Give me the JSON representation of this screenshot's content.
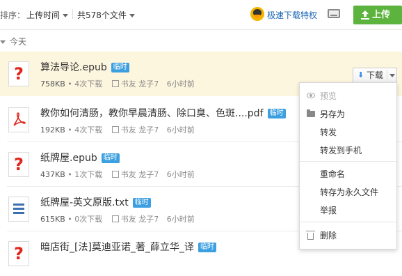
{
  "toolbar": {
    "sort_label": "排序：",
    "sort_value": "上传时间",
    "file_count": "共578个文件",
    "vip_link": "极速下载特权",
    "upload_label": "上传"
  },
  "group": {
    "label": "今天"
  },
  "files": [
    {
      "name": "算法导论.epub",
      "tag": "临时",
      "size": "758KB",
      "downloads": "4次下载",
      "source": "书友 龙子7",
      "time": "6小时前",
      "icon": "unknown-file-icon",
      "selected": true
    },
    {
      "name": "教你如何清肠，教你早晨清肠、除口臭、色斑....pdf",
      "tag": "临时",
      "size": "192KB",
      "downloads": "4次下载",
      "source": "书友 龙子7",
      "time": "6小时前",
      "icon": "pdf-file-icon"
    },
    {
      "name": "纸牌屋.epub",
      "tag": "临时",
      "size": "437KB",
      "downloads": "1次下载",
      "source": "书友 龙子7",
      "time": "6小时前",
      "icon": "unknown-file-icon"
    },
    {
      "name": "纸牌屋-英文原版.txt",
      "tag": "临时",
      "size": "615KB",
      "downloads": "0次下载",
      "source": "书友 龙子7",
      "time": "6小时前",
      "icon": "text-file-icon"
    },
    {
      "name": "暗店街_[法]莫迪亚诺_著_薛立华_译",
      "tag": "临时",
      "size": "",
      "downloads": "",
      "source": "",
      "time": "",
      "icon": "unknown-file-icon"
    }
  ],
  "download_button": {
    "label": "下载"
  },
  "menu": {
    "items": [
      {
        "label": "预览",
        "icon": "eye-icon",
        "disabled": true
      },
      {
        "label": "另存为",
        "icon": "folder-icon"
      },
      {
        "label": "转发"
      },
      {
        "label": "转发到手机"
      },
      {
        "label": "重命名"
      },
      {
        "label": "转存为永久文件"
      },
      {
        "label": "举报"
      },
      {
        "label": "删除",
        "icon": "trash-icon"
      }
    ]
  },
  "colors": {
    "accent_green": "#5cb43f",
    "link_blue": "#1a66b3",
    "tag_blue": "#3c9fe0",
    "selected_row": "#fdf6de",
    "file_icon_red": "#e0251b"
  }
}
